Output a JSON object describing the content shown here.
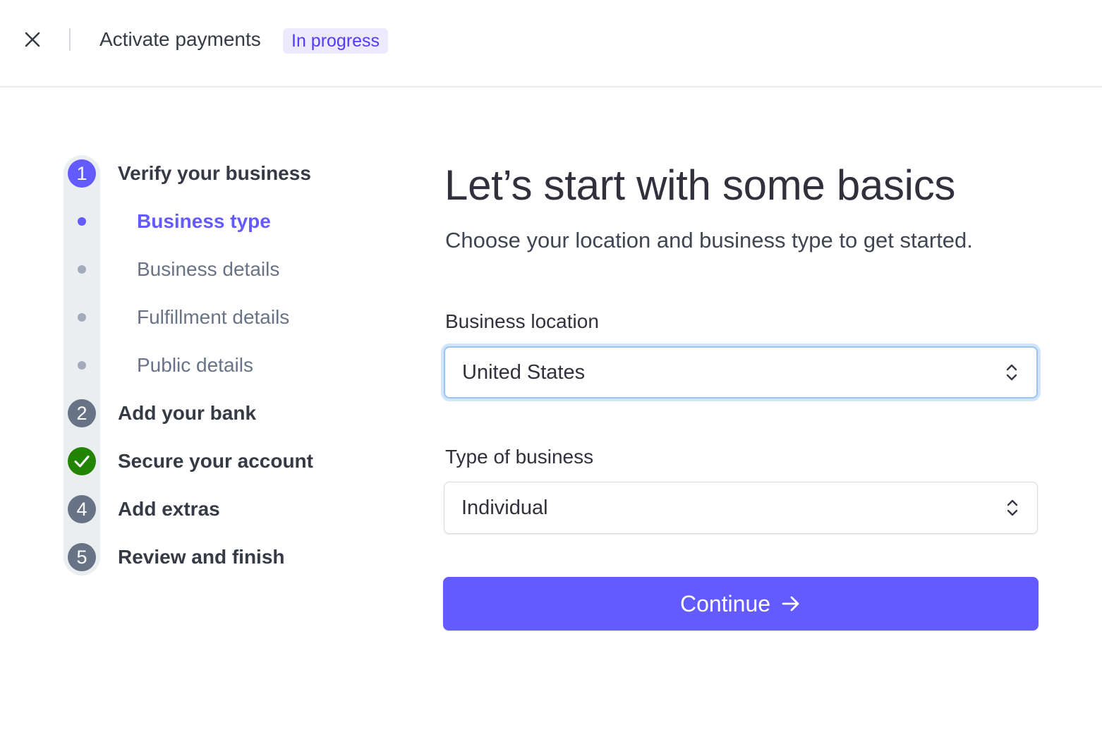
{
  "header": {
    "close_icon": "close-icon",
    "title": "Activate payments",
    "status_badge": "In progress"
  },
  "stepper": {
    "steps": [
      {
        "number": "1",
        "label": "Verify your business",
        "state": "active",
        "substeps": [
          {
            "label": "Business type",
            "state": "active"
          },
          {
            "label": "Business details",
            "state": "pending"
          },
          {
            "label": "Fulfillment details",
            "state": "pending"
          },
          {
            "label": "Public details",
            "state": "pending"
          }
        ]
      },
      {
        "number": "2",
        "label": "Add your bank",
        "state": "pending"
      },
      {
        "number": "",
        "label": "Secure your account",
        "state": "complete",
        "icon": "checkmark-icon"
      },
      {
        "number": "4",
        "label": "Add extras",
        "state": "pending"
      },
      {
        "number": "5",
        "label": "Review and finish",
        "state": "pending"
      }
    ]
  },
  "main": {
    "heading": "Let’s start with some basics",
    "subheading": "Choose your location and business type to get started.",
    "business_location": {
      "label": "Business location",
      "value": "United States"
    },
    "business_type": {
      "label": "Type of business",
      "value": "Individual"
    },
    "continue_label": "Continue",
    "continue_icon": "arrow-right-icon"
  },
  "colors": {
    "accent": "#635bff",
    "badge_bg": "#ede9fe",
    "complete": "#228403",
    "muted": "#687385"
  }
}
